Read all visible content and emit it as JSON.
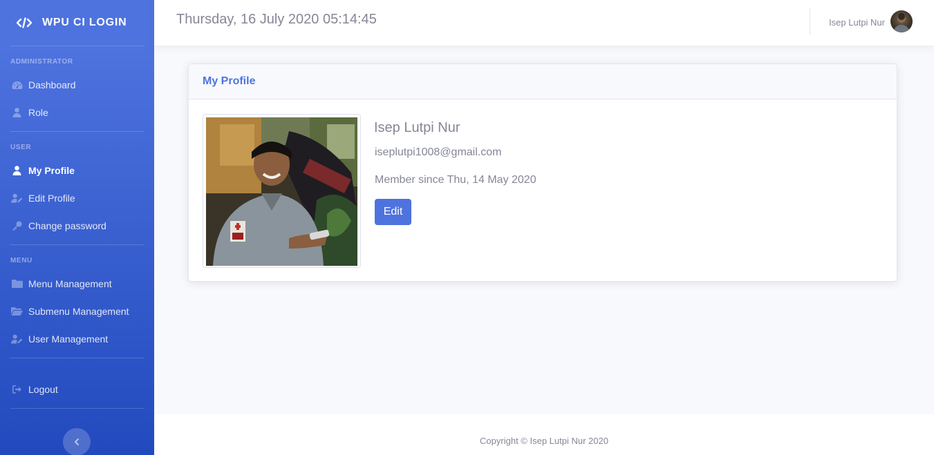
{
  "sidebar": {
    "brand": "WPU CI LOGIN",
    "sections": [
      {
        "heading": "ADMINISTRATOR",
        "items": [
          {
            "label": "Dashboard",
            "icon": "dashboard-icon"
          },
          {
            "label": "Role",
            "icon": "user-icon"
          }
        ]
      },
      {
        "heading": "USER",
        "items": [
          {
            "label": "My Profile",
            "icon": "user-icon",
            "active": true
          },
          {
            "label": "Edit Profile",
            "icon": "user-edit-icon"
          },
          {
            "label": "Change password",
            "icon": "key-icon"
          }
        ]
      },
      {
        "heading": "MENU",
        "items": [
          {
            "label": "Menu Management",
            "icon": "folder-icon"
          },
          {
            "label": "Submenu Management",
            "icon": "folder-open-icon"
          },
          {
            "label": "User Management",
            "icon": "user-edit-icon"
          }
        ]
      }
    ],
    "logout": "Logout"
  },
  "topbar": {
    "datetime": "Thursday, 16 July 2020 05:14:45",
    "username": "Isep Lutpi Nur"
  },
  "profile": {
    "card_title": "My Profile",
    "name": "Isep Lutpi Nur",
    "email": "iseplutpi1008@gmail.com",
    "member_since": "Member since Thu, 14 May 2020",
    "edit_label": "Edit"
  },
  "footer": {
    "copyright": "Copyright © Isep Lutpi Nur 2020"
  },
  "colors": {
    "primary": "#4e73df",
    "sidebar_gradient_end": "#224abe",
    "text_muted": "#858796"
  }
}
